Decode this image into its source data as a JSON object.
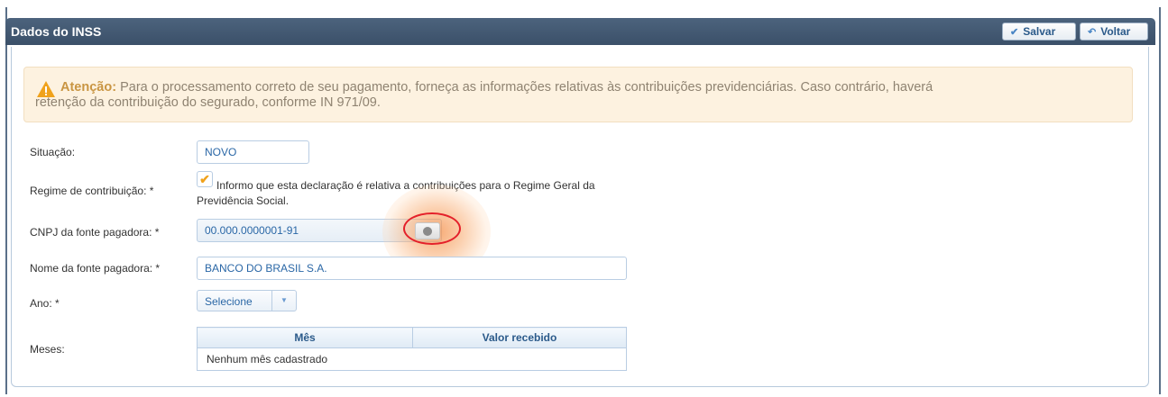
{
  "header": {
    "title": "Dados do INSS",
    "save_label": "Salvar",
    "back_label": "Voltar"
  },
  "alert": {
    "prefix": "Atenção:",
    "line1": "Para o processamento correto de seu pagamento, forneça as informações relativas às contribuições previdenciárias. Caso contrário, haverá",
    "line2": "retenção da contribuição do segurado, conforme IN 971/09."
  },
  "form": {
    "situacao_label": "Situação:",
    "situacao_value": "NOVO",
    "regime_label": "Regime de contribuição: *",
    "regime_text": "Informo que esta declaração é relativa a contribuições para o Regime Geral da Previdência Social.",
    "regime_checked": true,
    "cnpj_label": "CNPJ da fonte pagadora: *",
    "cnpj_value": "00.000.0000001-91",
    "nome_label": "Nome da fonte pagadora: *",
    "nome_value": "BANCO DO BRASIL S.A.",
    "ano_label": "Ano: *",
    "ano_selected": "Selecione",
    "meses_label": "Meses:"
  },
  "months_table": {
    "headers": [
      "Mês",
      "Valor recebido"
    ],
    "empty_text": "Nenhum mês cadastrado"
  },
  "colors": {
    "header_bg": "#3f556f",
    "accent": "#2a67a6",
    "warning": "#f0a21b",
    "highlight_ring": "#e4202a"
  }
}
